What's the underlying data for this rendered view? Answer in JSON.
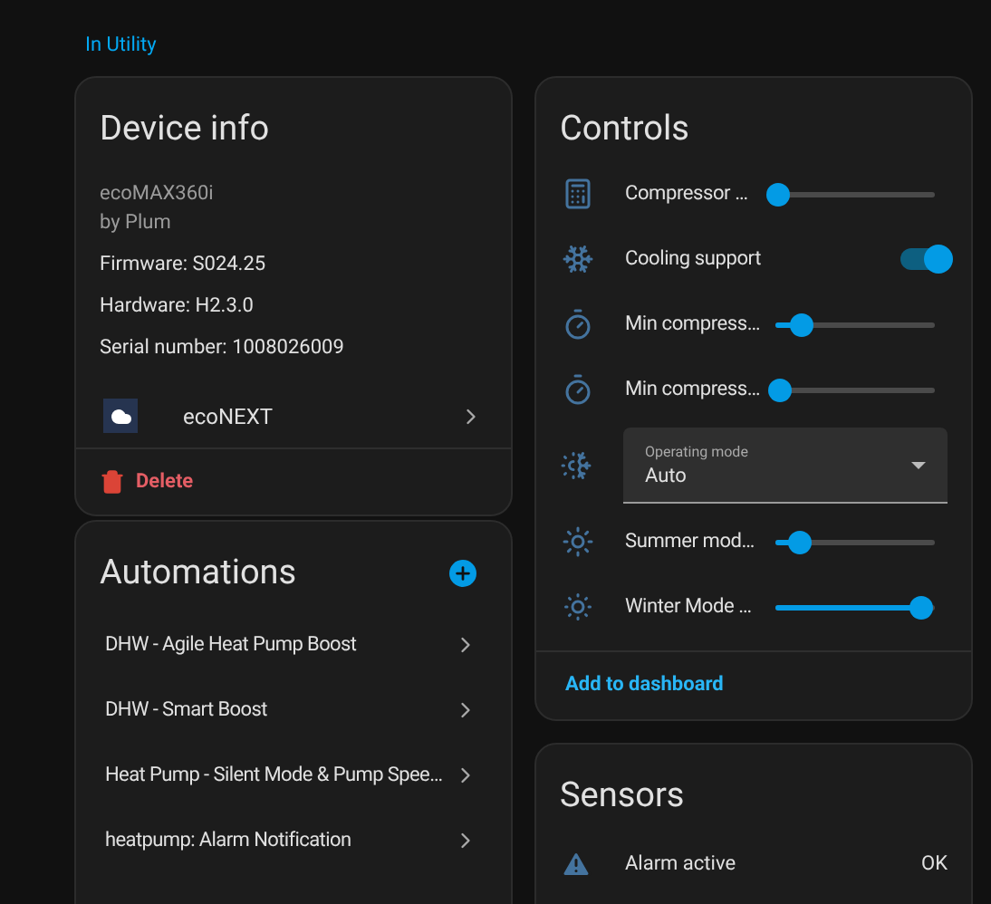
{
  "breadcrumb": "In Utility",
  "device_info": {
    "title": "Device info",
    "model": "ecoMAX360i",
    "manufacturer": "by Plum",
    "details": [
      "Firmware: S024.25",
      "Hardware: H2.3.0",
      "Serial number: 1008026009"
    ],
    "integration": "ecoNEXT",
    "delete": "Delete"
  },
  "automations": {
    "title": "Automations",
    "items": [
      "DHW - Agile Heat Pump Boost",
      "DHW - Smart Boost",
      "Heat Pump - Silent Mode & Pump Spee…",
      "heatpump: Alarm Notification"
    ]
  },
  "controls": {
    "title": "Controls",
    "rows": [
      {
        "kind": "slider",
        "label": "Compressor …",
        "level": 0.02
      },
      {
        "kind": "toggle",
        "label": "Cooling support",
        "on": true
      },
      {
        "kind": "slider",
        "label": "Min compress…",
        "level": 0.17
      },
      {
        "kind": "slider",
        "label": "Min compress…",
        "level": 0.03
      },
      {
        "kind": "select",
        "label": "Operating mode",
        "value": "Auto"
      },
      {
        "kind": "slider",
        "label": "Summer mod…",
        "level": 0.15
      },
      {
        "kind": "slider",
        "label": "Winter Mode …",
        "level": 0.92
      }
    ],
    "action": "Add to dashboard"
  },
  "sensors": {
    "title": "Sensors",
    "rows": [
      {
        "label": "Alarm active",
        "value": "OK"
      }
    ]
  }
}
